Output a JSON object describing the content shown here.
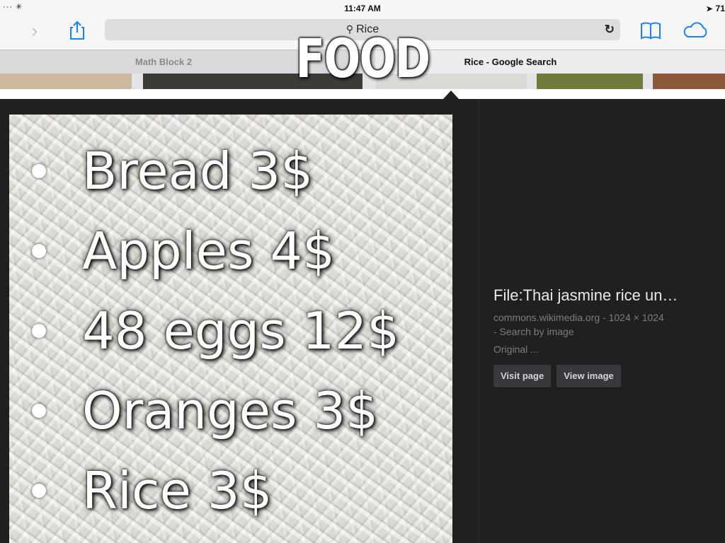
{
  "status_bar": {
    "left_icons": "··· ✳",
    "time": "11:47 AM",
    "right_text": "71"
  },
  "toolbar": {
    "forward_icon": "chevron-right-icon",
    "share_icon": "share-icon",
    "search_query": "Rice",
    "reload_icon": "reload-icon",
    "bookmarks_icon": "bookmarks-icon",
    "cloud_icon": "icloud-tabs-icon"
  },
  "tabs": [
    {
      "label": "Math Block 2",
      "active": false
    },
    {
      "label": "Rice - Google Search",
      "active": true
    }
  ],
  "slide": {
    "title": "FOOD",
    "items": [
      "Bread 3$",
      "Apples 4$",
      "48 eggs 12$",
      "Oranges 3$",
      "Rice 3$"
    ]
  },
  "image_info": {
    "title": "File:Thai jasmine rice un…",
    "source": "commons.wikimedia.org - 1024 × 1024",
    "search_by_image": " - Search by image",
    "original": "Original ...",
    "visit_page": "Visit page",
    "view_image": "View image"
  },
  "colors": {
    "pane_background": "#1f2022",
    "chrome_background": "#f6f6f7",
    "tab_bar": "#d9d9dc",
    "active_tab": "#ececee",
    "icon_blue": "#1a82f7"
  }
}
